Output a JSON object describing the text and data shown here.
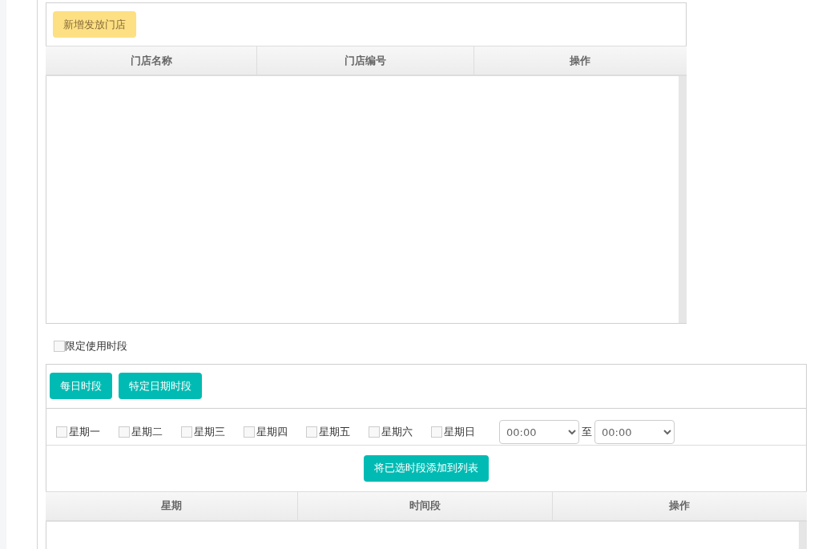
{
  "store_panel": {
    "add_button": "新增发放门店",
    "table": {
      "columns": [
        "门店名称",
        "门店编号",
        "操作"
      ]
    }
  },
  "limit_time": {
    "label": "限定使用时段",
    "checked": false
  },
  "time_panel": {
    "buttons": [
      "每日时段",
      "特定日期时段"
    ],
    "weekdays": [
      {
        "label": "星期一",
        "checked": false
      },
      {
        "label": "星期二",
        "checked": false
      },
      {
        "label": "星期三",
        "checked": false
      },
      {
        "label": "星期四",
        "checked": false
      },
      {
        "label": "星期五",
        "checked": false
      },
      {
        "label": "星期六",
        "checked": false
      },
      {
        "label": "星期日",
        "checked": false
      }
    ],
    "time_from": "00:00",
    "separator": "至",
    "time_to": "00:00",
    "add_button": "将已选时段添加到列表",
    "table": {
      "columns": [
        "星期",
        "时间段",
        "操作"
      ]
    }
  }
}
